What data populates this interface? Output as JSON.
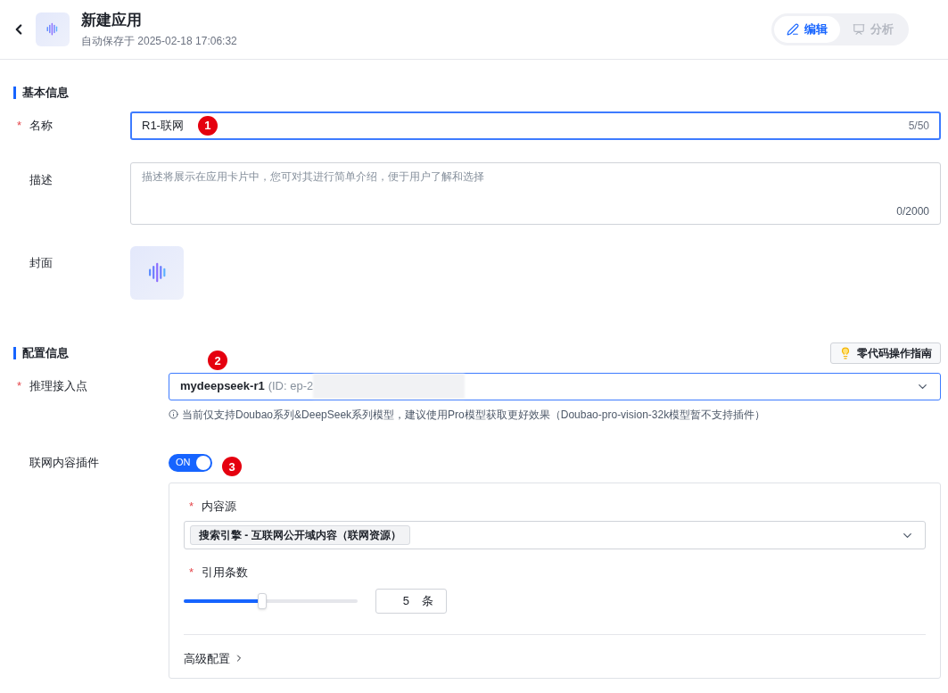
{
  "header": {
    "title": "新建应用",
    "autosave": "自动保存于 2025-02-18 17:06:32",
    "modes": [
      {
        "label": "编辑",
        "kind": "edit",
        "selected": true
      },
      {
        "label": "分析",
        "kind": "analyze",
        "selected": false
      }
    ]
  },
  "basic": {
    "title": "基本信息",
    "name": {
      "label": "名称",
      "mark": "*",
      "value": "R1-联网",
      "count": "5/50",
      "marker": "1"
    },
    "description": {
      "label": "描述",
      "placeholder": "描述将展示在应用卡片中，您可对其进行简单介绍，便于用户了解和选择",
      "count": "0/2000"
    },
    "cover": {
      "label": "封面"
    }
  },
  "config": {
    "title": "配置信息",
    "guide_button": "零代码操作指南",
    "endpoint": {
      "label": "推理接入点",
      "mark": "*",
      "value": "mydeepseek-r1",
      "id_text": "(ID: ep-2",
      "marker": "2",
      "hint": "当前仅支持Doubao系列&DeepSeek系列模型，建议使用Pro模型获取更好效果（Doubao-pro-vision-32k模型暂不支持插件）"
    },
    "plugin": {
      "label": "联网内容插件",
      "on": true,
      "switch_text": "ON",
      "marker": "3",
      "source": {
        "label": "内容源",
        "mark": "*",
        "tag": "搜索引擎 - 互联网公开域内容（联网资源）"
      },
      "count": {
        "label": "引用条数",
        "mark": "*",
        "level": 0.45,
        "value": "5",
        "unit": "条"
      },
      "advanced": "高级配置"
    }
  }
}
